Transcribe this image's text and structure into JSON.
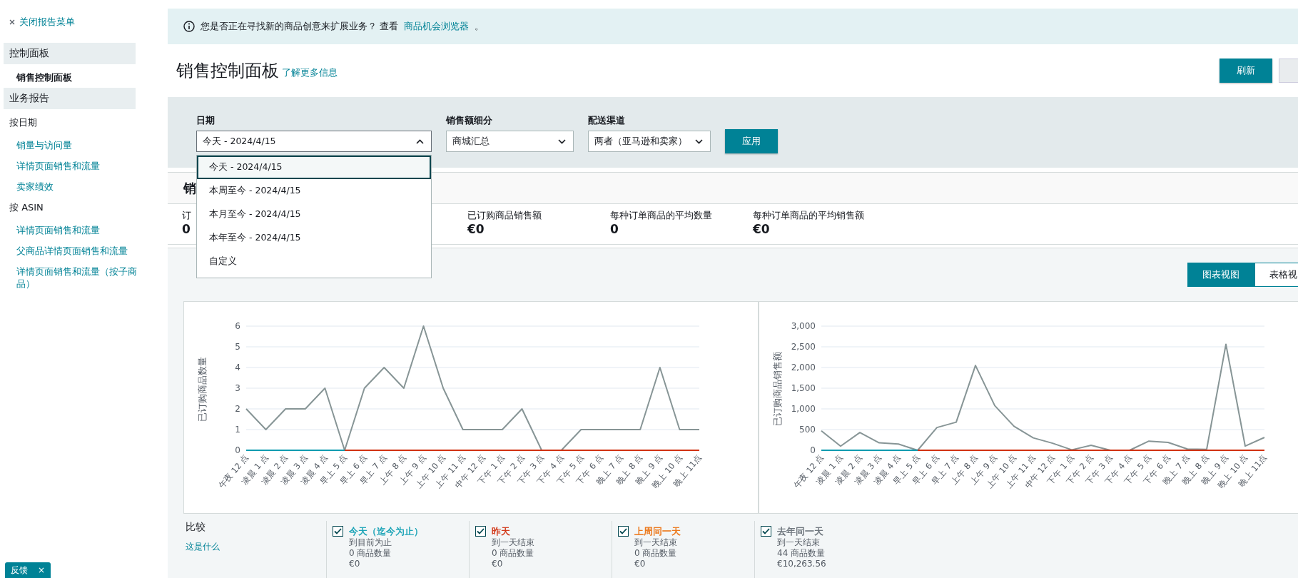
{
  "sidebar": {
    "close_link": "关闭报告菜单",
    "sections": [
      {
        "title": "控制面板",
        "items": [
          {
            "label": "销售控制面板",
            "selected": true
          }
        ]
      },
      {
        "title": "业务报告",
        "groups": [
          {
            "label": "按日期",
            "items": [
              {
                "label": "销量与访问量",
                "selected": false
              },
              {
                "label": "详情页面销售和流量",
                "selected": false
              },
              {
                "label": "卖家绩效",
                "selected": false
              }
            ]
          },
          {
            "label": "按 ASIN",
            "items": [
              {
                "label": "详情页面销售和流量",
                "selected": false
              },
              {
                "label": "父商品详情页面销售和流量",
                "selected": false
              },
              {
                "label": "详情页面销售和流量（按子商品）",
                "selected": false
              }
            ]
          }
        ]
      }
    ]
  },
  "banner": {
    "text": "您是否正在寻找新的商品创意来扩展业务？ 查看",
    "link": "商品机会浏览器",
    "end": "。"
  },
  "page": {
    "title": "销售控制面板",
    "learn_more": "了解更多信息",
    "refresh_button": "刷新"
  },
  "filters": {
    "fields": [
      {
        "label": "日期",
        "value": "今天 - 2024/4/15",
        "expanded": true
      },
      {
        "label": "销售额细分",
        "value": "商城汇总",
        "expanded": false
      },
      {
        "label": "配送渠道",
        "value": "两者（亚马逊和卖家）",
        "expanded": false
      }
    ],
    "apply_button": "应用",
    "date_options": [
      {
        "label": "今天 - 2024/4/15",
        "selected": true
      },
      {
        "label": "本周至今 - 2024/4/15",
        "selected": false
      },
      {
        "label": "本月至今 - 2024/4/15",
        "selected": false
      },
      {
        "label": "本年至今 - 2024/4/15",
        "selected": false
      },
      {
        "label": "自定义",
        "selected": false
      }
    ]
  },
  "snapshot": {
    "title": "销",
    "metrics": [
      {
        "label": "订",
        "value": "0"
      },
      {
        "label": "已订购商品销售额",
        "value": "€0"
      },
      {
        "label": "每种订单商品的平均数量",
        "value": "0"
      },
      {
        "label": "每种订单商品的平均销售额",
        "value": "€0"
      }
    ]
  },
  "comparison": {
    "view_tabs": [
      {
        "label": "图表视图",
        "selected": true
      },
      {
        "label": "表格视",
        "selected": false
      }
    ],
    "charts": [
      {
        "chart_data": {
          "type": "line",
          "ylabel": "已订购商品数量",
          "categories": [
            "午夜 12 点",
            "凌晨 1 点",
            "凌晨 2 点",
            "凌晨 3 点",
            "凌晨 4 点",
            "早上 5 点",
            "早上 6 点",
            "早上 7 点",
            "上午 8 点",
            "上午 9 点",
            "上午 10 点",
            "上午 11 点",
            "中午 12 点",
            "下午 1 点",
            "下午 2 点",
            "下午 3 点",
            "下午 4 点",
            "下午 5 点",
            "下午 6 点",
            "晚上 7 点",
            "晚上 8 点",
            "晚上 9 点",
            "晚上 10 点",
            "晚上 11点"
          ],
          "grid": true,
          "ylim": [
            0,
            6
          ],
          "yticks": [
            0,
            1,
            2,
            3,
            4,
            5,
            6
          ],
          "series": [
            {
              "color": "#879596",
              "values": [
                2,
                1,
                2,
                2,
                3,
                0,
                3,
                4,
                3,
                6,
                3,
                1,
                1,
                1,
                2,
                0,
                0,
                1,
                1,
                1,
                1,
                4,
                1,
                1
              ]
            },
            {
              "color": "#d13212",
              "values": [
                null,
                null,
                null,
                null,
                null,
                0,
                0,
                0,
                0,
                0,
                0,
                0,
                0,
                0,
                0,
                0,
                0,
                0,
                0,
                0,
                0,
                0,
                0,
                0
              ]
            },
            {
              "color": "#0a9bb0",
              "values": [
                0,
                0,
                0,
                0,
                0,
                0,
                null,
                null,
                null,
                null,
                null,
                null,
                null,
                null,
                null,
                null,
                null,
                null,
                null,
                null,
                null,
                null,
                null,
                null
              ]
            }
          ]
        }
      },
      {
        "chart_data": {
          "type": "line",
          "ylabel": "已订购商品销售额",
          "categories": [
            "午夜 12 点",
            "凌晨 1 点",
            "凌晨 2 点",
            "凌晨 3 点",
            "凌晨 4 点",
            "早上 5 点",
            "早上 6 点",
            "早上 7 点",
            "上午 8 点",
            "上午 9 点",
            "上午 10 点",
            "上午 11 点",
            "中午 12 点",
            "下午 1 点",
            "下午 2 点",
            "下午 3 点",
            "下午 4 点",
            "下午 5 点",
            "下午 6 点",
            "晚上 7 点",
            "晚上 8 点",
            "晚上 9 点",
            "晚上 10 点",
            "晚上 11点"
          ],
          "grid": true,
          "ylim": [
            0,
            3000
          ],
          "yticks": [
            0,
            500,
            {
              "value": 1000,
              "label": "1,000"
            },
            {
              "value": 1500,
              "label": "1,500"
            },
            {
              "value": 2000,
              "label": "2,000"
            },
            {
              "value": 2500,
              "label": "2,500"
            },
            {
              "value": 3000,
              "label": "3,000"
            }
          ],
          "series": [
            {
              "color": "#879596",
              "values": [
                470,
                100,
                430,
                180,
                150,
                0,
                550,
                680,
                2050,
                1080,
                580,
                300,
                170,
                10,
                120,
                0,
                0,
                220,
                190,
                30,
                20,
                2560,
                100,
                310
              ]
            },
            {
              "color": "#d13212",
              "values": [
                null,
                null,
                null,
                null,
                null,
                0,
                0,
                0,
                0,
                0,
                0,
                0,
                0,
                0,
                0,
                0,
                0,
                0,
                0,
                0,
                0,
                0,
                0,
                0
              ]
            },
            {
              "color": "#0a9bb0",
              "values": [
                0,
                0,
                0,
                0,
                0,
                0,
                null,
                null,
                null,
                null,
                null,
                null,
                null,
                null,
                null,
                null,
                null,
                null,
                null,
                null,
                null,
                null,
                null,
                null
              ]
            }
          ]
        }
      }
    ],
    "compare": {
      "title": "比较",
      "help_link": "这是什么",
      "items": [
        {
          "label": "今天（迄今为止）",
          "color": "#12a0b4",
          "checked": true,
          "period": "到目前为止",
          "count": "0 商品数量",
          "amount": "€0"
        },
        {
          "label": "昨天",
          "color": "#d13212",
          "checked": true,
          "period": "到一天结束",
          "count": "0 商品数量",
          "amount": "€0"
        },
        {
          "label": "上周同一天",
          "color": "#ec7211",
          "checked": true,
          "period": "到一天结束",
          "count": "0 商品数量",
          "amount": "€0"
        },
        {
          "label": "去年同一天",
          "color": "#687078",
          "checked": true,
          "period": "到一天结束",
          "count": "44 商品数量",
          "amount": "€10,263.56"
        }
      ]
    }
  },
  "feedback": {
    "label": "反馈",
    "close": "×"
  }
}
